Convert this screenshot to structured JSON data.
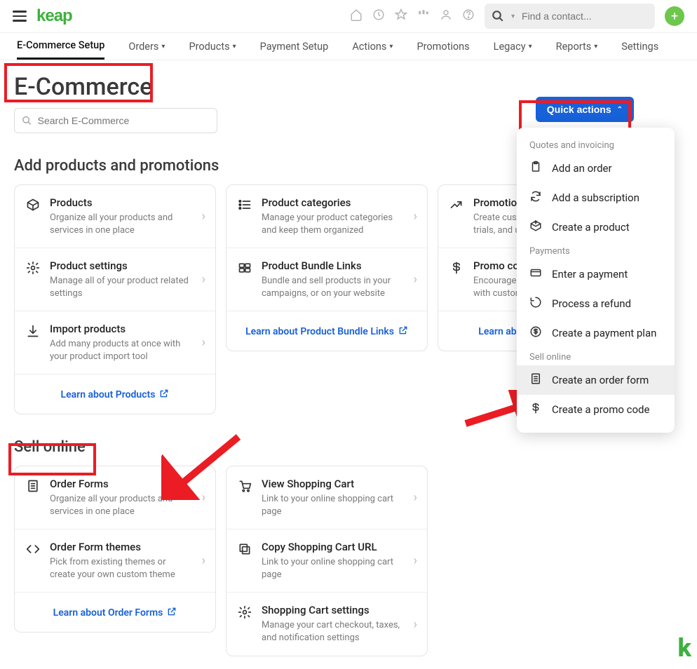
{
  "header": {
    "logo_text": "keap",
    "search_placeholder": "Find a contact..."
  },
  "nav": {
    "items": [
      {
        "label": "E-Commerce Setup",
        "active": true,
        "drop": false
      },
      {
        "label": "Orders",
        "drop": true
      },
      {
        "label": "Products",
        "drop": true
      },
      {
        "label": "Payment Setup",
        "drop": false
      },
      {
        "label": "Actions",
        "drop": true
      },
      {
        "label": "Promotions",
        "drop": false
      },
      {
        "label": "Legacy",
        "drop": true
      },
      {
        "label": "Reports",
        "drop": true
      },
      {
        "label": "Settings",
        "drop": false
      }
    ]
  },
  "page_title": "E-Commerce",
  "page_search_placeholder": "Search E-Commerce",
  "sections": {
    "add": {
      "heading": "Add products and promotions",
      "cols": [
        {
          "cards": [
            {
              "icon": "box-icon",
              "title": "Products",
              "sub": "Organize all your products and services in one place"
            },
            {
              "icon": "gear-icon",
              "title": "Product settings",
              "sub": "Manage all of your product related settings"
            },
            {
              "icon": "download-icon",
              "title": "Import products",
              "sub": "Add many products at once with your product import tool"
            }
          ],
          "learn": "Learn about Products"
        },
        {
          "cards": [
            {
              "icon": "list-icon",
              "title": "Product categories",
              "sub": "Manage your product categories and keep them organized"
            },
            {
              "icon": "bundle-icon",
              "title": "Product Bundle Links",
              "sub": "Bundle and sell products in your campaigns, or on your website"
            }
          ],
          "learn": "Learn about Product Bundle Links"
        },
        {
          "cards": [
            {
              "icon": "trend-icon",
              "title": "Promotions",
              "sub": "Create custom discounts, free trials, and upsells"
            },
            {
              "icon": "dollar-icon",
              "title": "Promo codes",
              "sub": "Encourage your customers to buy with custom promo codes"
            }
          ],
          "learn": "Learn about Promotions"
        }
      ]
    },
    "sell": {
      "heading": "Sell online",
      "cols": [
        {
          "cards": [
            {
              "icon": "form-icon",
              "title": "Order Forms",
              "sub": "Organize all your products and services in one place"
            },
            {
              "icon": "code-icon",
              "title": "Order Form themes",
              "sub": "Pick from existing themes or create your own custom theme"
            }
          ],
          "learn": "Learn about Order Forms"
        },
        {
          "cards": [
            {
              "icon": "cart-icon",
              "title": "View Shopping Cart",
              "sub": "Link to your online shopping cart page"
            },
            {
              "icon": "copy-icon",
              "title": "Copy Shopping Cart URL",
              "sub": "Link to your online shopping cart page"
            },
            {
              "icon": "gear-icon",
              "title": "Shopping Cart settings",
              "sub": "Manage your cart checkout, taxes, and notification settings"
            }
          ]
        }
      ]
    }
  },
  "quick_actions": {
    "button": "Quick actions",
    "groups": [
      {
        "title": "Quotes and invoicing",
        "items": [
          {
            "icon": "clipboard-icon",
            "label": "Add an order"
          },
          {
            "icon": "refresh-dollar-icon",
            "label": "Add a subscription"
          },
          {
            "icon": "box-plus-icon",
            "label": "Create a product"
          }
        ]
      },
      {
        "title": "Payments",
        "items": [
          {
            "icon": "card-icon",
            "label": "Enter a payment"
          },
          {
            "icon": "undo-icon",
            "label": "Process a refund"
          },
          {
            "icon": "dollar-circle-icon",
            "label": "Create a payment plan"
          }
        ]
      },
      {
        "title": "Sell online",
        "items": [
          {
            "icon": "form-icon",
            "label": "Create an order form",
            "hl": true
          },
          {
            "icon": "dollar-icon",
            "label": "Create a promo code"
          }
        ]
      }
    ]
  }
}
